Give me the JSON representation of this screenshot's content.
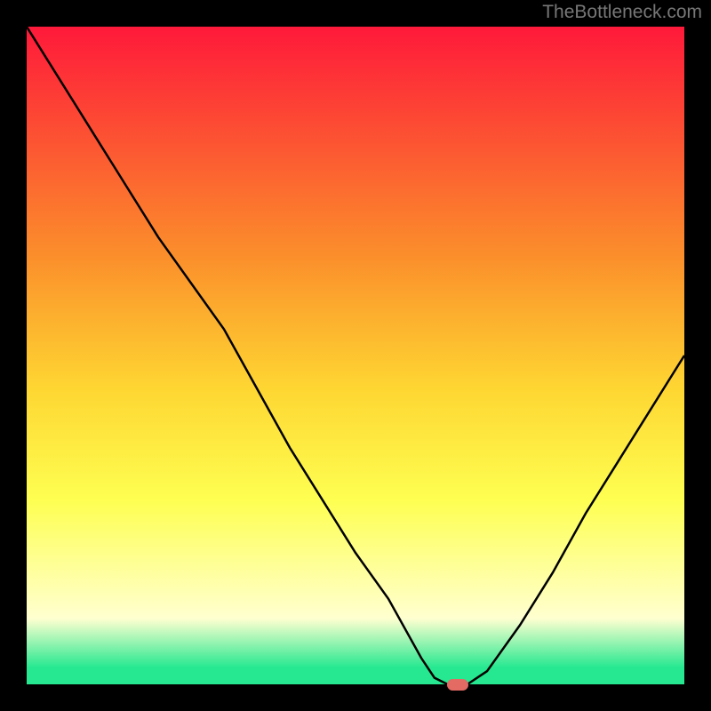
{
  "watermark": "TheBottleneck.com",
  "colors": {
    "gradient_top": "#fe193a",
    "gradient_mid_upper": "#fb8f2b",
    "gradient_mid": "#fed632",
    "gradient_mid_lower": "#feff51",
    "gradient_pale": "#ffffd0",
    "gradient_green": "#25e890",
    "curve_stroke": "#000000",
    "marker_fill": "#e46a64",
    "page_bg": "#000000"
  },
  "chart_data": {
    "type": "line",
    "title": "",
    "xlabel": "",
    "ylabel": "",
    "x_axis_visible": false,
    "y_axis_visible": false,
    "xlim": [
      0,
      100
    ],
    "ylim": [
      0,
      100
    ],
    "grid": false,
    "legend": false,
    "series": [
      {
        "name": "bottleneck-curve",
        "x": [
          0,
          5,
          10,
          15,
          20,
          25,
          30,
          35,
          40,
          45,
          50,
          55,
          60,
          62,
          64,
          67,
          70,
          75,
          80,
          85,
          90,
          95,
          100
        ],
        "y": [
          100,
          92,
          84,
          76,
          68,
          61,
          54,
          45,
          36,
          28,
          20,
          13,
          4,
          1,
          0,
          0,
          2,
          9,
          17,
          26,
          34,
          42,
          50
        ]
      }
    ],
    "marker": {
      "x": 65.5,
      "y": 0,
      "shape": "pill",
      "color": "#e46a64"
    },
    "background_gradient": {
      "direction": "vertical",
      "stops": [
        {
          "pos": 0.0,
          "color": "#fe193a"
        },
        {
          "pos": 0.35,
          "color": "#fb8f2b"
        },
        {
          "pos": 0.55,
          "color": "#fed632"
        },
        {
          "pos": 0.72,
          "color": "#feff51"
        },
        {
          "pos": 0.9,
          "color": "#ffffd0"
        },
        {
          "pos": 0.975,
          "color": "#25e890"
        },
        {
          "pos": 1.0,
          "color": "#25e890"
        }
      ]
    }
  }
}
